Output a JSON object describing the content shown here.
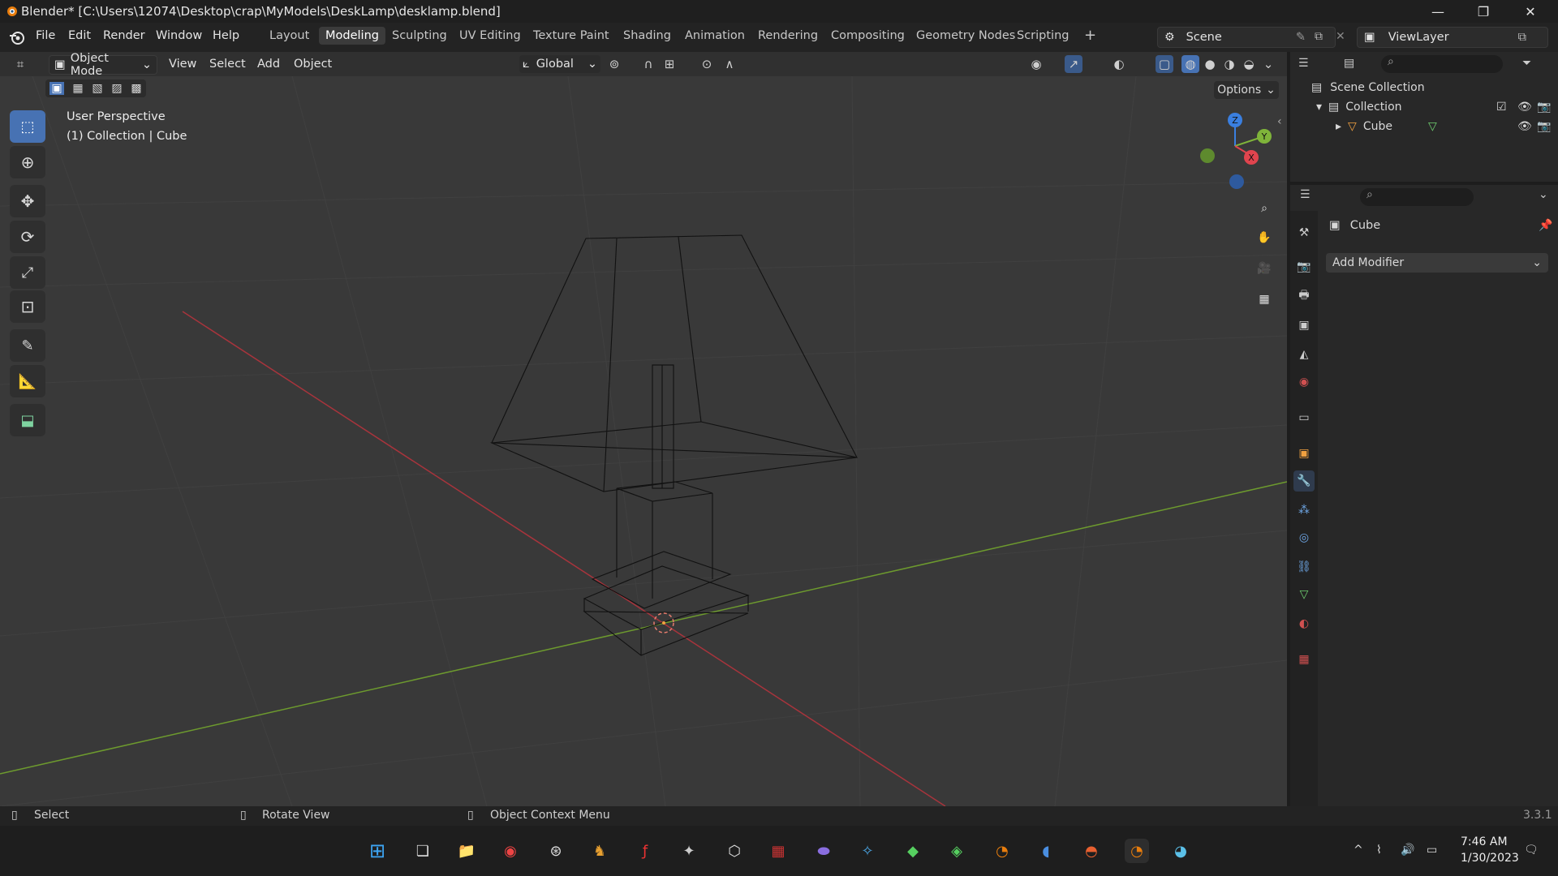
{
  "window": {
    "title": "Blender* [C:\\Users\\12074\\Desktop\\crap\\MyModels\\DeskLamp\\desklamp.blend]",
    "controls": [
      "—",
      "❐",
      "✕"
    ]
  },
  "menu": {
    "items": [
      "File",
      "Edit",
      "Render",
      "Window",
      "Help"
    ],
    "workspaces": [
      "Layout",
      "Modeling",
      "Sculpting",
      "UV Editing",
      "Texture Paint",
      "Shading",
      "Animation",
      "Rendering",
      "Compositing",
      "Geometry Nodes",
      "Scripting"
    ],
    "active_workspace": "Modeling",
    "add_tab": "+",
    "scene": "Scene",
    "view_layer": "ViewLayer"
  },
  "viewport_header": {
    "mode": "Object Mode",
    "menus": [
      "View",
      "Select",
      "Add",
      "Object"
    ],
    "transform_orientation": "Global",
    "options": "Options"
  },
  "viewport": {
    "perspective_label": "User Perspective",
    "collection_label": "(1) Collection | Cube",
    "gizmo_axes": [
      "Z",
      "Y",
      "X"
    ]
  },
  "outliner": {
    "scene_collection": "Scene Collection",
    "collection": "Collection",
    "object": "Cube"
  },
  "properties": {
    "object_name": "Cube",
    "add_modifier": "Add Modifier"
  },
  "statusbar": {
    "select": "Select",
    "rotate": "Rotate View",
    "context_menu": "Object Context Menu",
    "version": "3.3.1"
  },
  "taskbar": {
    "time": "7:46 AM",
    "date": "1/30/2023"
  },
  "colors": {
    "accent": "#4772b3",
    "x_axis": "#e0444e",
    "y_axis": "#7fb43a",
    "z_axis": "#3a7fe0"
  }
}
